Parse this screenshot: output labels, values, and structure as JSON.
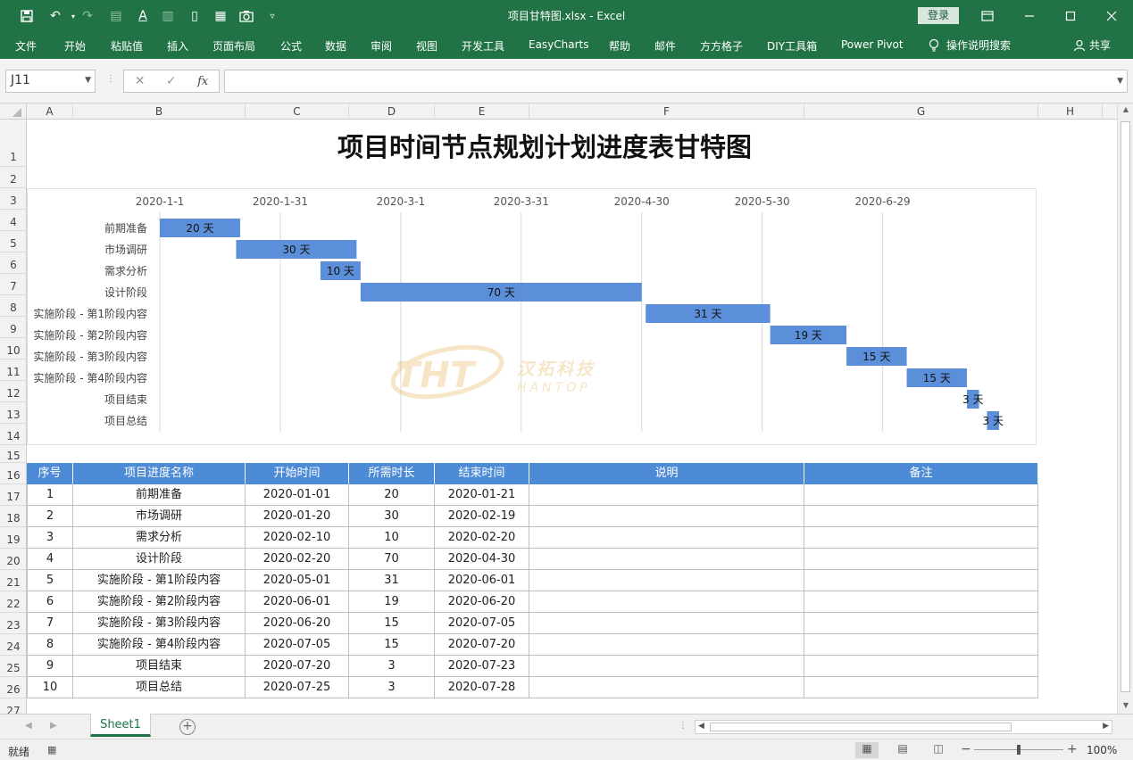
{
  "window": {
    "title": "项目甘特图.xlsx  -  Excel",
    "login_label": "登录"
  },
  "ribbon": {
    "tabs": [
      "文件",
      "开始",
      "粘贴值",
      "插入",
      "页面布局",
      "公式",
      "数据",
      "审阅",
      "视图",
      "开发工具",
      "EasyCharts",
      "帮助",
      "邮件",
      "方方格子",
      "DIY工具箱",
      "Power Pivot"
    ],
    "search_label": "操作说明搜索",
    "share_label": "共享"
  },
  "formula_bar": {
    "name_box": "J11",
    "formula": ""
  },
  "grid": {
    "columns": [
      "A",
      "B",
      "C",
      "D",
      "E",
      "F",
      "G",
      "H"
    ],
    "rows": [
      "1",
      "2",
      "3",
      "4",
      "5",
      "6",
      "7",
      "8",
      "9",
      "10",
      "11",
      "12",
      "13",
      "14",
      "15",
      "16",
      "17",
      "18",
      "19",
      "20",
      "21",
      "22",
      "23",
      "24",
      "25",
      "26",
      "27"
    ]
  },
  "sheet": {
    "title": "项目时间节点规划计划进度表甘特图"
  },
  "chart_data": {
    "type": "bar",
    "subtype": "gantt",
    "x_axis_type": "date",
    "x_ticks": [
      "2020-1-1",
      "2020-1-31",
      "2020-3-1",
      "2020-3-31",
      "2020-4-30",
      "2020-5-30",
      "2020-6-29"
    ],
    "xlim": [
      "2020-01-01",
      "2020-07-28"
    ],
    "grid": true,
    "categories": [
      "前期准备",
      "市场调研",
      "需求分析",
      "设计阶段",
      "实施阶段 - 第1阶段内容",
      "实施阶段 - 第2阶段内容",
      "实施阶段 - 第3阶段内容",
      "实施阶段 - 第4阶段内容",
      "项目结束",
      "项目总结"
    ],
    "start": [
      "2020-01-01",
      "2020-01-20",
      "2020-02-10",
      "2020-02-20",
      "2020-05-01",
      "2020-06-01",
      "2020-06-20",
      "2020-07-05",
      "2020-07-20",
      "2020-07-25"
    ],
    "durations": [
      20,
      30,
      10,
      70,
      31,
      19,
      15,
      15,
      3,
      3
    ],
    "data_labels": [
      "20 天",
      "30 天",
      "10 天",
      "70 天",
      "31 天",
      "19 天",
      "15 天",
      "15 天",
      "3 天",
      "3 天"
    ],
    "bar_color": "#5b8fd9",
    "watermark": {
      "main": "THT",
      "cn": "汉拓科技",
      "en": "HANTOP"
    }
  },
  "table": {
    "headers": [
      "序号",
      "项目进度名称",
      "开始时间",
      "所需时长",
      "结束时间",
      "说明",
      "备注"
    ],
    "rows": [
      [
        "1",
        "前期准备",
        "2020-01-01",
        "20",
        "2020-01-21",
        "",
        ""
      ],
      [
        "2",
        "市场调研",
        "2020-01-20",
        "30",
        "2020-02-19",
        "",
        ""
      ],
      [
        "3",
        "需求分析",
        "2020-02-10",
        "10",
        "2020-02-20",
        "",
        ""
      ],
      [
        "4",
        "设计阶段",
        "2020-02-20",
        "70",
        "2020-04-30",
        "",
        ""
      ],
      [
        "5",
        "实施阶段 - 第1阶段内容",
        "2020-05-01",
        "31",
        "2020-06-01",
        "",
        ""
      ],
      [
        "6",
        "实施阶段 - 第2阶段内容",
        "2020-06-01",
        "19",
        "2020-06-20",
        "",
        ""
      ],
      [
        "7",
        "实施阶段 - 第3阶段内容",
        "2020-06-20",
        "15",
        "2020-07-05",
        "",
        ""
      ],
      [
        "8",
        "实施阶段 - 第4阶段内容",
        "2020-07-05",
        "15",
        "2020-07-20",
        "",
        ""
      ],
      [
        "9",
        "项目结束",
        "2020-07-20",
        "3",
        "2020-07-23",
        "",
        ""
      ],
      [
        "10",
        "项目总结",
        "2020-07-25",
        "3",
        "2020-07-28",
        "",
        ""
      ]
    ],
    "header_color": "#4e8bd6"
  },
  "sheet_tabs": {
    "active": "Sheet1"
  },
  "status_bar": {
    "status": "就绪",
    "zoom": "100%"
  },
  "theme": {
    "accent": "#217346"
  }
}
